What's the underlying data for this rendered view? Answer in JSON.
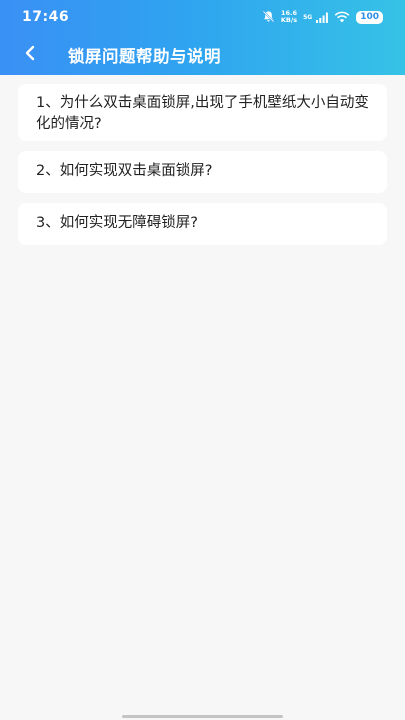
{
  "status_bar": {
    "time": "17:46",
    "speed_value": "16.6",
    "speed_unit": "KB/s",
    "network": "5G",
    "battery": "100"
  },
  "nav": {
    "title": "锁屏问题帮助与说明"
  },
  "faq": {
    "items": [
      {
        "label": "1、为什么双击桌面锁屏,出现了手机壁纸大小自动变化的情况?"
      },
      {
        "label": "2、如何实现双击桌面锁屏?"
      },
      {
        "label": "3、如何实现无障碍锁屏?"
      }
    ]
  },
  "colors": {
    "header_start": "#3a90f5",
    "header_end": "#36c2e6",
    "background": "#f7f7f7"
  }
}
